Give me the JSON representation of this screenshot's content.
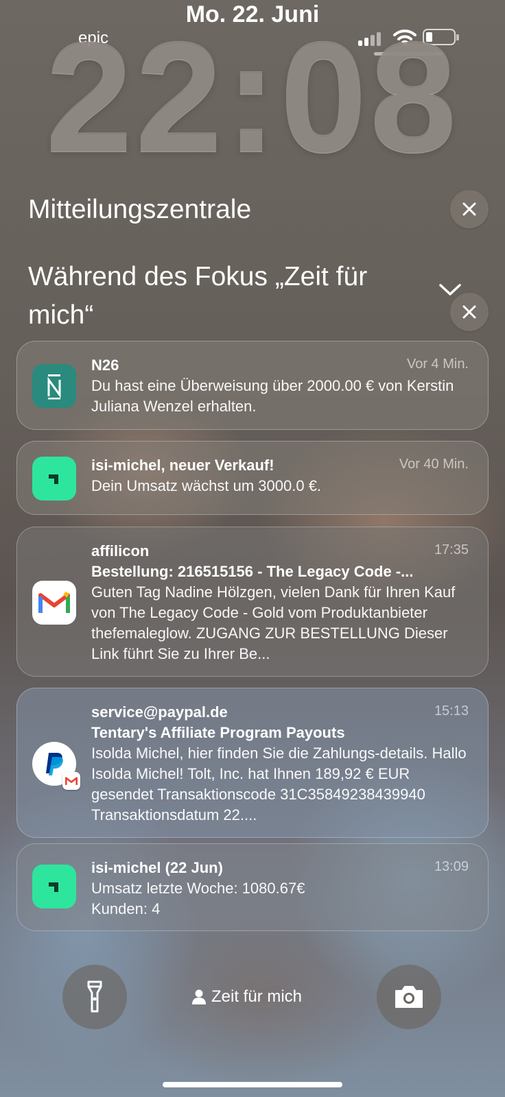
{
  "status_bar": {
    "date": "Mo. 22. Juni",
    "carrier": "epic",
    "signal_icon": "cellular-signal-icon",
    "wifi_icon": "wifi-icon",
    "battery_icon": "battery-icon",
    "battery_level": 0.15
  },
  "clock": "22:08",
  "notification_center": {
    "title": "Mitteilungszentrale",
    "focus_group_title": "Während des Fokus „Zeit für mich“"
  },
  "notifications": [
    {
      "app": "N26",
      "icon": "n26-app-icon",
      "title": "N26",
      "time": "Vor 4 Min.",
      "body": "Du hast eine Überweisung über 2000.00 € von Kerstin Juliana Wenzel erhalten."
    },
    {
      "app": "isi-michel",
      "icon": "shop-app-icon",
      "title": "isi-michel, neuer Verkauf!",
      "time": "Vor 40 Min.",
      "body": "Dein Umsatz wächst um 3000.0 €."
    },
    {
      "app": "Gmail",
      "icon": "gmail-icon",
      "title": "affilicon",
      "time": "17:35",
      "subtitle": "Bestellung: 216515156 - The Legacy Code -...",
      "body": "Guten Tag Nadine Hölzgen, vielen Dank für Ihren Kauf von The Legacy Code - Gold vom Produktanbieter thefemaleglow. ZUGANG ZUR BESTELLUNG Dieser Link führt Sie zu Ihrer Be..."
    },
    {
      "app": "PayPal",
      "icon": "paypal-icon",
      "title": "service@paypal.de",
      "time": "15:13",
      "subtitle": "Tentary's Affiliate Program Payouts",
      "body": "Isolda Michel, hier finden Sie die Zahlungs-details. Hallo Isolda Michel! Tolt, Inc. hat Ihnen 189,92 € EUR gesendet Transaktionscode 31C35849238439940 Transaktionsdatum 22...."
    },
    {
      "app": "isi-michel",
      "icon": "shop-app-icon",
      "title": "isi-michel (22 Jun)",
      "time": "13:09",
      "body_line1": "Umsatz letzte Woche: 1080.67€",
      "body_line2": "Kunden: 4"
    }
  ],
  "bottom": {
    "focus_label": "Zeit für mich",
    "flashlight_icon": "flashlight-icon",
    "camera_icon": "camera-icon"
  },
  "colors": {
    "n26_teal": "#2a8a7e",
    "shop_green": "#2ee59d",
    "gmail_red": "#ea4335",
    "paypal_blue": "#003087"
  }
}
